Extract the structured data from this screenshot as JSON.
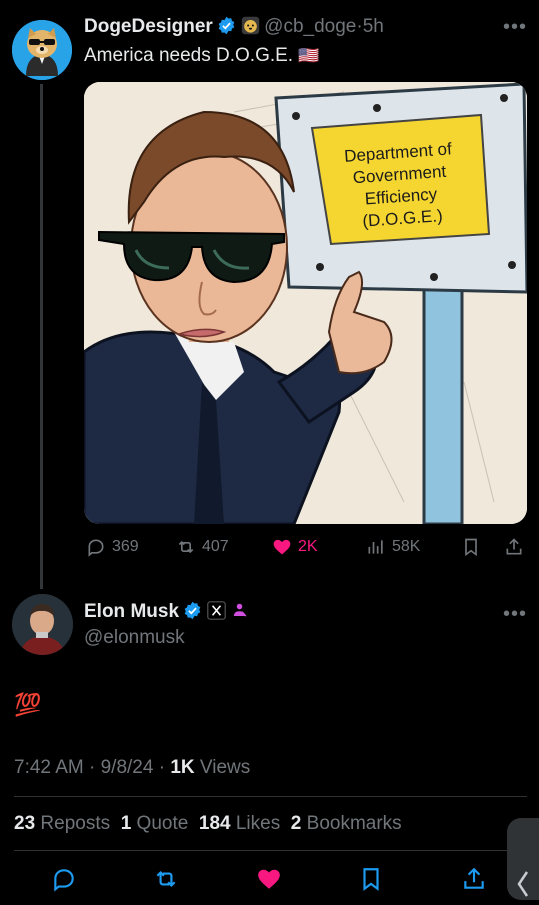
{
  "original_tweet": {
    "display_name": "DogeDesigner",
    "handle": "@cb_doge",
    "time": "5h",
    "separator": "·",
    "text": "America needs D.O.G.E.",
    "flag": "🇺🇸",
    "image": {
      "sign_lines": [
        "Department of",
        "Government",
        "Efficiency",
        "(D.O.G.E.)"
      ]
    },
    "actions": {
      "replies": "369",
      "reposts": "407",
      "likes": "2K",
      "views": "58K"
    }
  },
  "reply_tweet": {
    "display_name": "Elon Musk",
    "handle": "@elonmusk",
    "text": "💯",
    "timestamp": "7:42 AM · 9/8/24 · ",
    "views_count": "1K",
    "views_label": " Views",
    "stats": {
      "reposts_count": "23",
      "reposts_label": "Reposts",
      "quotes_count": "1",
      "quotes_label": "Quote",
      "likes_count": "184",
      "likes_label": "Likes",
      "bookmarks_count": "2",
      "bookmarks_label": "Bookmarks"
    }
  },
  "colors": {
    "background": "#000000",
    "text": "#e7e9ea",
    "muted": "#71767b",
    "verified_blue": "#1d9bf0",
    "like_pink": "#f91880",
    "sign_yellow": "#f5d630",
    "affiliate_pink": "#d04ee0"
  },
  "icons": [
    "verified-icon",
    "doge-badge-icon",
    "reply-icon",
    "repost-icon",
    "heart-icon",
    "views-icon",
    "bookmark-icon",
    "share-icon",
    "more-icon",
    "x-logo-icon",
    "affiliate-icon"
  ]
}
